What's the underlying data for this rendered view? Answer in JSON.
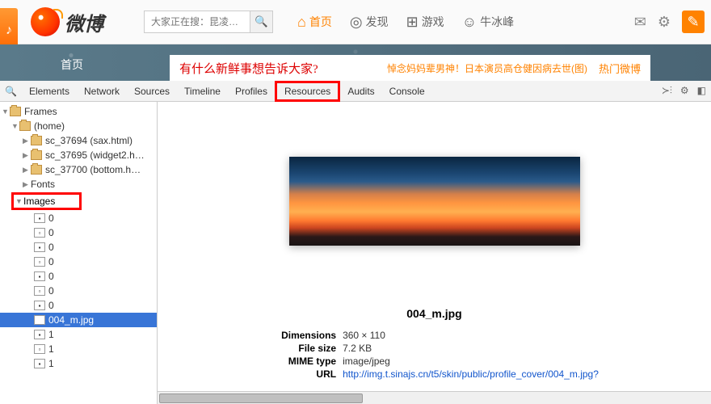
{
  "header": {
    "logo_text": "微博",
    "search_placeholder": "大家正在搜：昆凌…",
    "nav": [
      {
        "icon": "⌂",
        "label": "首页",
        "active": true
      },
      {
        "icon": "◎",
        "label": "发现"
      },
      {
        "icon": "⊕",
        "label": "游戏"
      },
      {
        "icon": "☺",
        "label": "牛冰峰"
      }
    ]
  },
  "banner": {
    "home_label": "首页",
    "prompt": "有什么新鲜事想告诉大家?",
    "news": "悼念妈妈辈男神！日本演员高仓健因病去世(图)",
    "hot_label": "热门微博"
  },
  "devtools": {
    "tabs": [
      "Elements",
      "Network",
      "Sources",
      "Timeline",
      "Profiles",
      "Resources",
      "Audits",
      "Console"
    ],
    "highlighted_tab": "Resources",
    "tree": {
      "root": "Frames",
      "home": "(home)",
      "files": [
        {
          "name": "sc_37694 (sax.html)"
        },
        {
          "name": "sc_37695 (widget2.h…"
        },
        {
          "name": "sc_37700 (bottom.h…"
        }
      ],
      "fonts": "Fonts",
      "images_label": "Images",
      "images": [
        {
          "name": "0"
        },
        {
          "name": "0"
        },
        {
          "name": "0"
        },
        {
          "name": "0"
        },
        {
          "name": "0"
        },
        {
          "name": "0"
        },
        {
          "name": "0"
        },
        {
          "name": "004_m.jpg",
          "selected": true
        },
        {
          "name": "1"
        },
        {
          "name": "1"
        },
        {
          "name": "1"
        }
      ]
    },
    "preview": {
      "filename": "004_m.jpg",
      "rows": [
        {
          "label": "Dimensions",
          "value": "360 × 110"
        },
        {
          "label": "File size",
          "value": "7.2 KB"
        },
        {
          "label": "MIME type",
          "value": "image/jpeg"
        },
        {
          "label": "URL",
          "value": "http://img.t.sinajs.cn/t5/skin/public/profile_cover/004_m.jpg?",
          "link": true
        }
      ]
    }
  }
}
